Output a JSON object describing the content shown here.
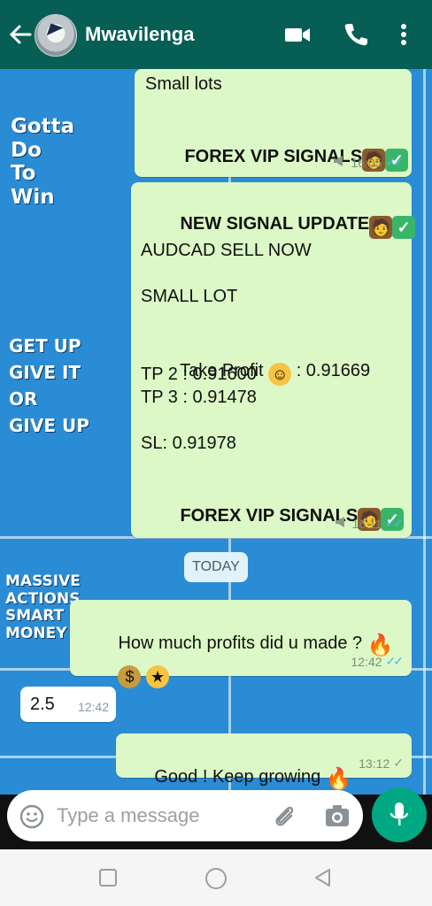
{
  "header": {
    "contact_name": "Mwavilenga",
    "icons": [
      "back-arrow-icon",
      "video-call-icon",
      "phone-icon",
      "more-options-icon"
    ]
  },
  "wallpaper": {
    "text_1": "Gotta\nDo\nTo\nWin",
    "text_2": "GET UP\nGIVE IT\nOR\nGIVE UP",
    "text_3": "MASSIVE\nACTIONS\nSMART\nMONEY"
  },
  "messages": [
    {
      "id": "m1",
      "direction": "outgoing",
      "lines": [
        "Small lots",
        "",
        "FOREX VIP SIGNALS"
      ],
      "time": "16:05",
      "status": "read"
    },
    {
      "id": "m2",
      "direction": "outgoing",
      "line_1": "NEW SIGNAL UPDATE",
      "line_2": "AUDCAD SELL NOW",
      "line_3": "SMALL LOT",
      "line_4a": "Take Profit",
      "line_4b": " : 0.91669",
      "line_5": "TP 2 : 0.91600",
      "line_6": "TP 3 : 0.91478",
      "line_7": "SL: 0.91978",
      "line_8": "FOREX VIP SIGNALS",
      "time": "16:11",
      "status": "read"
    },
    {
      "id": "m3",
      "direction": "outgoing",
      "line_1": "How much profits did u made ?",
      "time": "12:42",
      "status": "read"
    },
    {
      "id": "m4",
      "direction": "incoming",
      "line_1": "2.5",
      "time": "12:42"
    },
    {
      "id": "m5",
      "direction": "outgoing",
      "line_1": "Good ! Keep growing",
      "time": "13:12",
      "status": "delivered"
    }
  ],
  "date_divider": "TODAY",
  "composer": {
    "placeholder": "Type a message",
    "icons": [
      "emoji-icon",
      "attach-icon",
      "camera-icon",
      "mic-icon"
    ]
  },
  "navbar": {
    "icons": [
      "recent-apps-icon",
      "home-icon",
      "back-icon"
    ]
  },
  "colors": {
    "header": "#075e54",
    "outgoing_bubble": "#dcf8c6",
    "incoming_bubble": "#ffffff",
    "mic_button": "#00a884",
    "read_ticks": "#4fb6ec"
  }
}
